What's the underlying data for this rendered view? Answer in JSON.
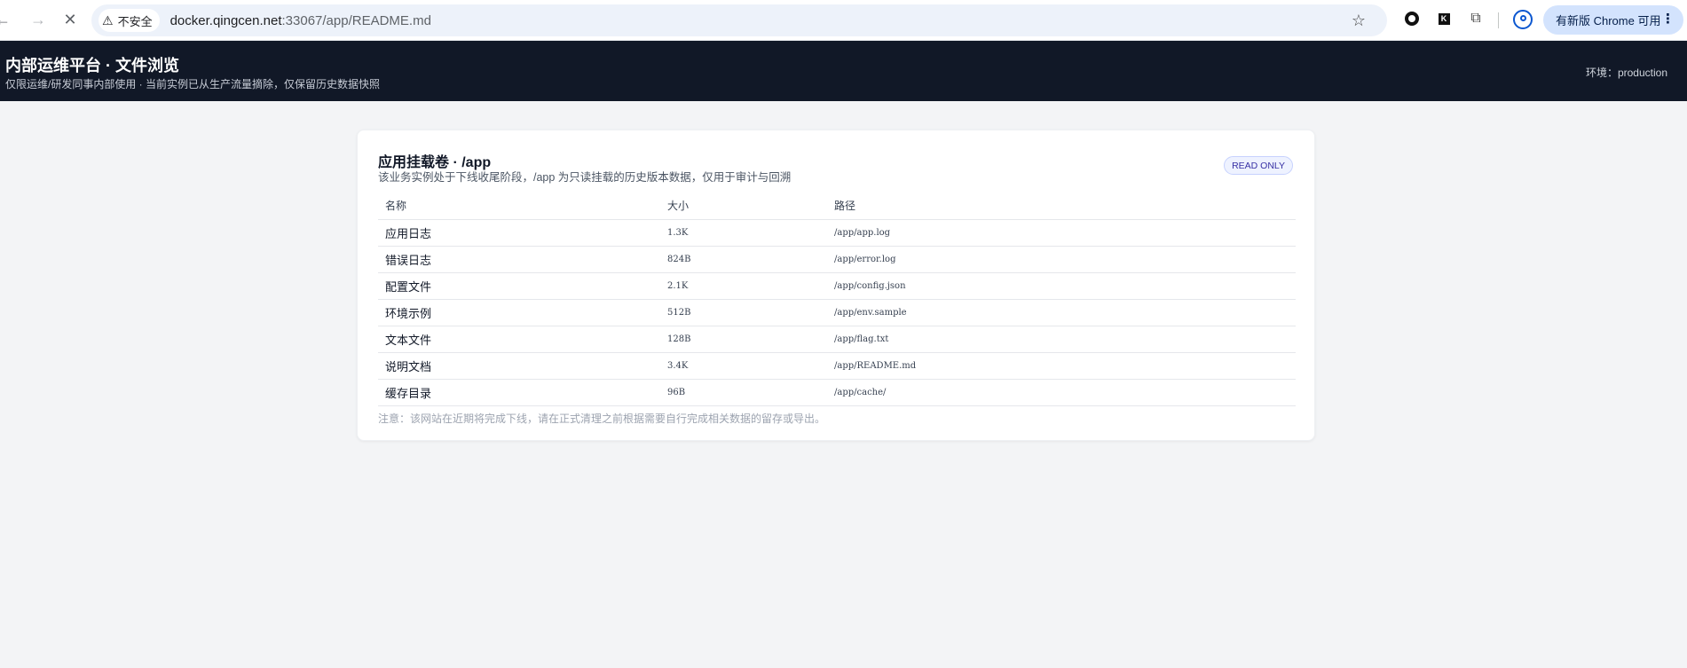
{
  "browser": {
    "security_label": "不安全",
    "url_host": "docker.qingcen.net",
    "url_path": ":33067/app/README.md",
    "update_button": "有新版 Chrome 可用",
    "ext2_label": "K"
  },
  "header": {
    "title": "内部运维平台 · 文件浏览",
    "subtitle": "仅限运维/研发同事内部使用 · 当前实例已从生产流量摘除，仅保留历史数据快照",
    "environment": "环境：production"
  },
  "card": {
    "title": "应用挂载卷 · /app",
    "description": "该业务实例处于下线收尾阶段，/app 为只读挂载的历史版本数据，仅用于审计与回溯",
    "badge": "READ ONLY",
    "columns": [
      "名称",
      "大小",
      "路径"
    ],
    "rows": [
      {
        "name": "应用日志",
        "size": "1.3K",
        "path": "/app/app.log"
      },
      {
        "name": "错误日志",
        "size": "824B",
        "path": "/app/error.log"
      },
      {
        "name": "配置文件",
        "size": "2.1K",
        "path": "/app/config.json"
      },
      {
        "name": "环境示例",
        "size": "512B",
        "path": "/app/env.sample"
      },
      {
        "name": "文本文件",
        "size": "128B",
        "path": "/app/flag.txt"
      },
      {
        "name": "说明文档",
        "size": "3.4K",
        "path": "/app/README.md"
      },
      {
        "name": "缓存目录",
        "size": "96B",
        "path": "/app/cache/"
      }
    ],
    "note": "注意：该网站在近期将完成下线，请在正式清理之前根据需要自行完成相关数据的留存或导出。"
  },
  "colors": {
    "header_bg": "#111827",
    "page_bg": "#f3f4f6",
    "badge_bg": "#eef2ff",
    "update_bg": "#d3e3fd"
  }
}
